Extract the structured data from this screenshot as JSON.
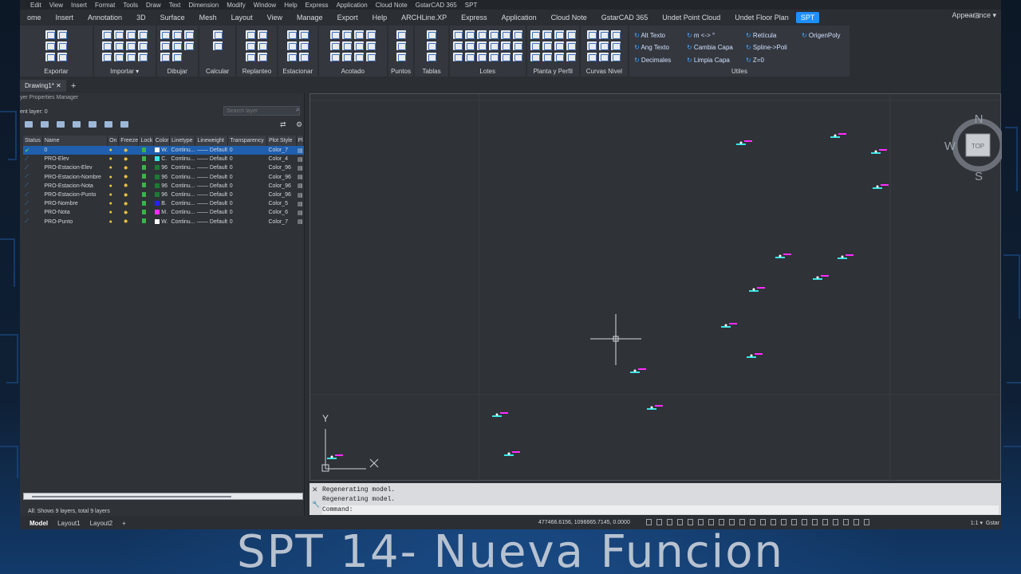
{
  "menu": [
    "Edit",
    "View",
    "Insert",
    "Format",
    "Tools",
    "Draw",
    "Text",
    "Dimension",
    "Modify",
    "Window",
    "Help",
    "Express",
    "Application",
    "Cloud Note",
    "GstarCAD 365",
    "SPT"
  ],
  "tabs": [
    "ome",
    "Insert",
    "Annotation",
    "3D",
    "Surface",
    "Mesh",
    "Layout",
    "View",
    "Manage",
    "Export",
    "Help",
    "ARCHLine.XP",
    "Express",
    "Application",
    "Cloud Note",
    "GstarCAD 365",
    "Undet Point Cloud",
    "Undet Floor Plan",
    "SPT"
  ],
  "appearance": "Appearance ▾",
  "panels": [
    {
      "label": "Exportar"
    },
    {
      "label": "Importar ▾"
    },
    {
      "label": "Dibujar"
    },
    {
      "label": "Calcular"
    },
    {
      "label": "Replanteo"
    },
    {
      "label": "Estacionar"
    },
    {
      "label": "Acotado"
    },
    {
      "label": "Puntos"
    },
    {
      "label": "Tablas"
    },
    {
      "label": "Lotes"
    },
    {
      "label": "Planta y Perfil"
    },
    {
      "label": "Curvas Nivel"
    }
  ],
  "utiles": {
    "label": "Utiles",
    "items": [
      "Alt Texto",
      "m <-> °",
      "Retícula",
      "OrigenPoly",
      "Ang Texto",
      "Cambia Capa",
      "Spline->Poli",
      "",
      "Decimales",
      "Limpia Capa",
      "Z=0",
      ""
    ]
  },
  "doc_tab": "Drawing1*",
  "layer_manager": {
    "title": "yer Properties Manager",
    "current": "ent layer: 0",
    "search_placeholder": "Search layer",
    "columns": [
      "Status",
      "Name",
      "On",
      "Freeze",
      "Lock",
      "Color",
      "Linetype",
      "Lineweight",
      "Transparency",
      "Plot Style",
      "Pl"
    ],
    "rows": [
      {
        "name": "0",
        "color": "W.",
        "color_hex": "#ffffff",
        "linetype": "Continu...",
        "lineweight": "—— Default",
        "transparency": "0",
        "plot": "Color_7"
      },
      {
        "name": "PRO-Elev",
        "color": "C.",
        "color_hex": "#39e6e6",
        "linetype": "Continu...",
        "lineweight": "—— Default",
        "transparency": "0",
        "plot": "Color_4"
      },
      {
        "name": "PRO-Estacion-Elev",
        "color": "96",
        "color_hex": "#1c7a32",
        "linetype": "Continu...",
        "lineweight": "—— Default",
        "transparency": "0",
        "plot": "Color_96"
      },
      {
        "name": "PRO-Estacion-Nombre",
        "color": "96",
        "color_hex": "#1c7a32",
        "linetype": "Continu...",
        "lineweight": "—— Default",
        "transparency": "0",
        "plot": "Color_96"
      },
      {
        "name": "PRO-Estacion-Nota",
        "color": "96",
        "color_hex": "#1c7a32",
        "linetype": "Continu...",
        "lineweight": "—— Default",
        "transparency": "0",
        "plot": "Color_96"
      },
      {
        "name": "PRO-Estacion-Punto",
        "color": "96",
        "color_hex": "#1c7a32",
        "linetype": "Continu...",
        "lineweight": "—— Default",
        "transparency": "0",
        "plot": "Color_96"
      },
      {
        "name": "PRO-Nombre",
        "color": "B.",
        "color_hex": "#2424ff",
        "linetype": "Continu...",
        "lineweight": "—— Default",
        "transparency": "0",
        "plot": "Color_5"
      },
      {
        "name": "PRO-Nota",
        "color": "M.",
        "color_hex": "#ff2cff",
        "linetype": "Continu...",
        "lineweight": "—— Default",
        "transparency": "0",
        "plot": "Color_6"
      },
      {
        "name": "PRO-Punto",
        "color": "W.",
        "color_hex": "#ffffff",
        "linetype": "Continu...",
        "lineweight": "—— Default",
        "transparency": "0",
        "plot": "Color_7"
      }
    ],
    "status": "All: Shows 9 layers, total 9 layers"
  },
  "viewcube": {
    "n": "N",
    "w": "W",
    "s": "S",
    "top": "TOP"
  },
  "ucs": {
    "y": "Y"
  },
  "command": {
    "history": [
      "Regenerating model.",
      "Regenerating model."
    ],
    "prompt": "Command:"
  },
  "status_bar": {
    "layouts": [
      "Model",
      "Layout1",
      "Layout2"
    ],
    "coords": "477466.6156, 1096665.7145, 0.0000",
    "scale": "1:1 ▾",
    "brand": "Gstar"
  },
  "caption": "SPT 14- Nueva Funcion"
}
